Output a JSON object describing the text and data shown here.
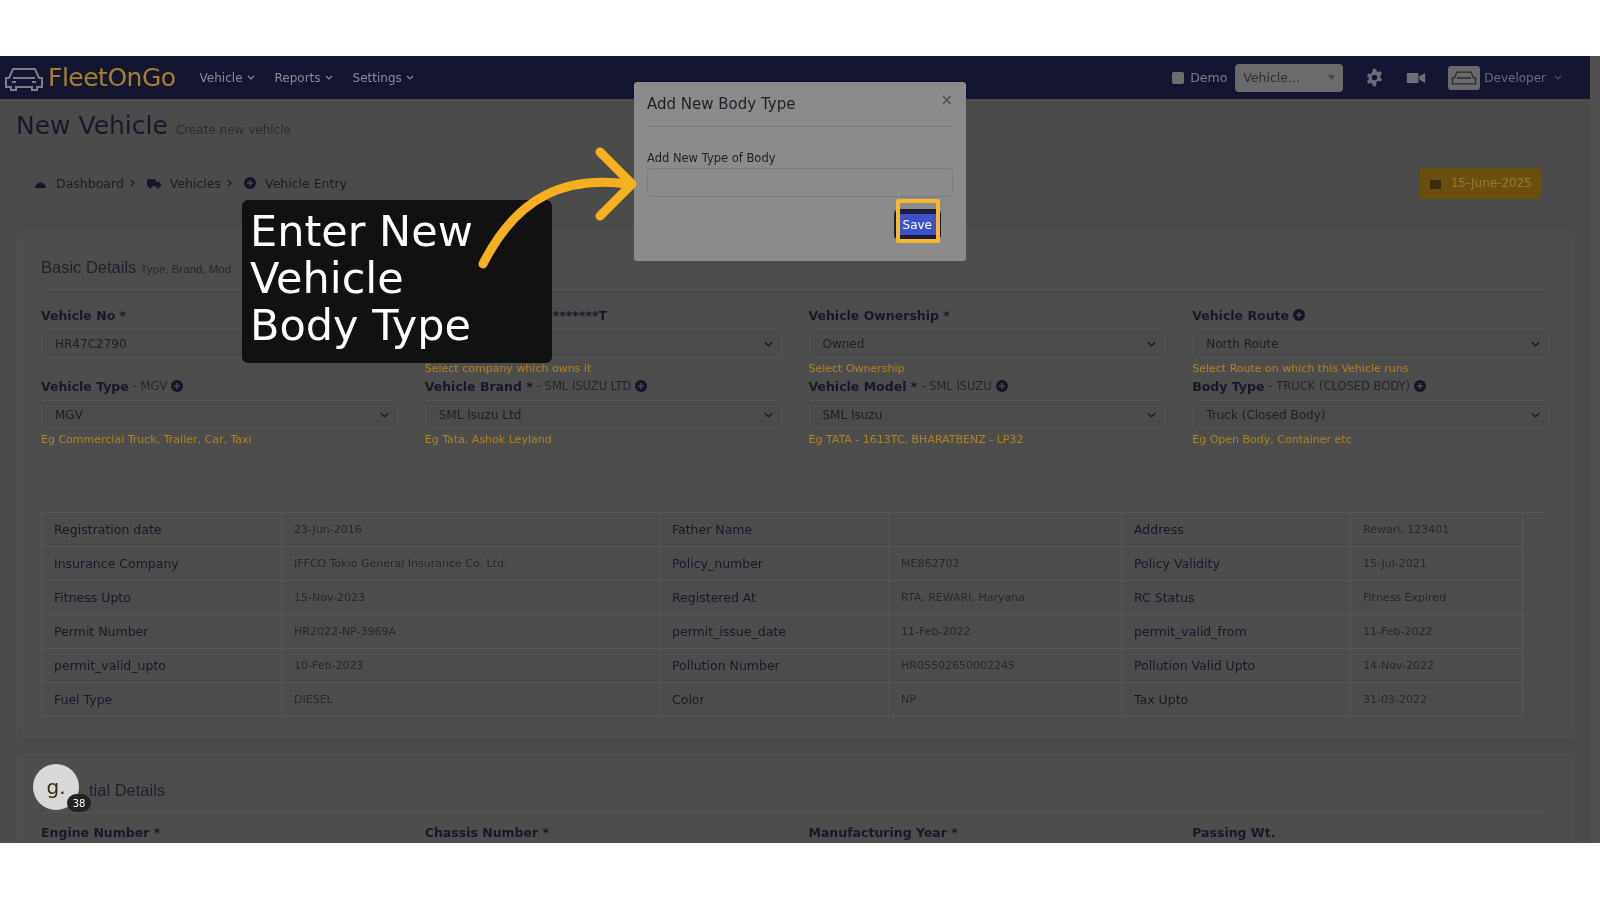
{
  "header": {
    "logo": "FleetOnGo",
    "nav": [
      {
        "label": "Vehicle"
      },
      {
        "label": "Reports"
      },
      {
        "label": "Settings"
      }
    ],
    "demo": {
      "label": "Demo",
      "checked": false
    },
    "vehicle_select": {
      "value": "Vehicle..."
    },
    "user": {
      "name": "Developer"
    }
  },
  "page": {
    "title": "New Vehicle",
    "subtitle": "Create new vehicle"
  },
  "breadcrumbs": [
    {
      "label": "Dashboard"
    },
    {
      "label": "Vehicles"
    },
    {
      "label": "Vehicle Entry"
    }
  ],
  "date_button": {
    "label": "15-June-2025"
  },
  "basic_details": {
    "title": "Basic Details",
    "subtitle": "Type, Brand, Mod",
    "fields": [
      {
        "kind": "input",
        "label": "Vehicle No *",
        "value": "HR47C2790"
      },
      {
        "kind": "select",
        "label": "*******T",
        "hint": "Select company which owns it"
      },
      {
        "kind": "select",
        "label": "Vehicle Ownership *",
        "value": "Owned",
        "hint": "Select Ownership"
      },
      {
        "kind": "select",
        "label": "Vehicle Route",
        "add": true,
        "value": "North Route",
        "hint": "Select Route on which this Vehicle runs"
      },
      {
        "kind": "select",
        "label": "Vehicle Type",
        "detail": "- MGV",
        "add": true,
        "value": "MGV",
        "hint": "Eg Commercial Truck, Trailer, Car, Taxi"
      },
      {
        "kind": "select",
        "label": "Vehicle Brand *",
        "detail": "- SML ISUZU LTD",
        "add": true,
        "value": "SML Isuzu Ltd",
        "hint": "Eg Tata, Ashok Leyland"
      },
      {
        "kind": "select",
        "label": "Vehicle Model *",
        "detail": "- SML ISUZU",
        "add": true,
        "value": "SML Isuzu",
        "hint": "Eg TATA - 1613TC, BHARATBENZ - LP32"
      },
      {
        "kind": "select",
        "label": "Body Type",
        "detail": "- TRUCK (CLOSED BODY)",
        "add": true,
        "value": "Truck (Closed Body)",
        "hint": "Eg Open Body, Container etc"
      }
    ],
    "table": {
      "rows": [
        [
          {
            "label": "Registration date",
            "value": "23-Jun-2016"
          },
          {
            "label": "Father Name"
          },
          {
            "label": "Address",
            "value": "Rewari, 123401"
          }
        ],
        [
          {
            "label": "Insurance Company",
            "value": "IFFCO Tokio General Insurance Co. Ltd."
          },
          {
            "label": "Policy_number",
            "value": "ME862702"
          },
          {
            "label": "Policy Validity",
            "value": "15-Jul-2021"
          }
        ],
        [
          {
            "label": "Fitness Upto",
            "value": "15-Nov-2023"
          },
          {
            "label": "Registered At",
            "value": "RTA, REWARI, Haryana"
          },
          {
            "label": "RC Status",
            "value": "Fitness Expired"
          }
        ],
        [
          {
            "label": "Permit Number",
            "value": "HR2022-NP-3969A"
          },
          {
            "label": "permit_issue_date",
            "value": "11-Feb-2022"
          },
          {
            "label": "permit_valid_from",
            "value": "11-Feb-2022"
          }
        ],
        [
          {
            "label": "permit_valid_upto",
            "value": "10-Feb-2023"
          },
          {
            "label": "Pollution Number",
            "value": "HR05502650002245"
          },
          {
            "label": "Pollution Valid Upto",
            "value": "14-Nov-2022"
          }
        ],
        [
          {
            "label": "Fuel Type",
            "value": "DIESEL"
          },
          {
            "label": "Color",
            "value": "NP"
          },
          {
            "label": "Tax Upto",
            "value": "31-03-2022"
          }
        ]
      ]
    }
  },
  "second_section": {
    "title": "tial Details",
    "fields": [
      {
        "label": "Engine Number *"
      },
      {
        "label": "Chassis Number *"
      },
      {
        "label": "Manufacturing Year *"
      },
      {
        "label": "Passing Wt."
      }
    ]
  },
  "modal": {
    "title": "Add New Body Type",
    "close": "×",
    "field_label": "Add New Type of Body",
    "save": "Save"
  },
  "tutorial": {
    "callout": "Enter New Vehicle Body Type",
    "avatar": "g.",
    "badge": "38"
  }
}
